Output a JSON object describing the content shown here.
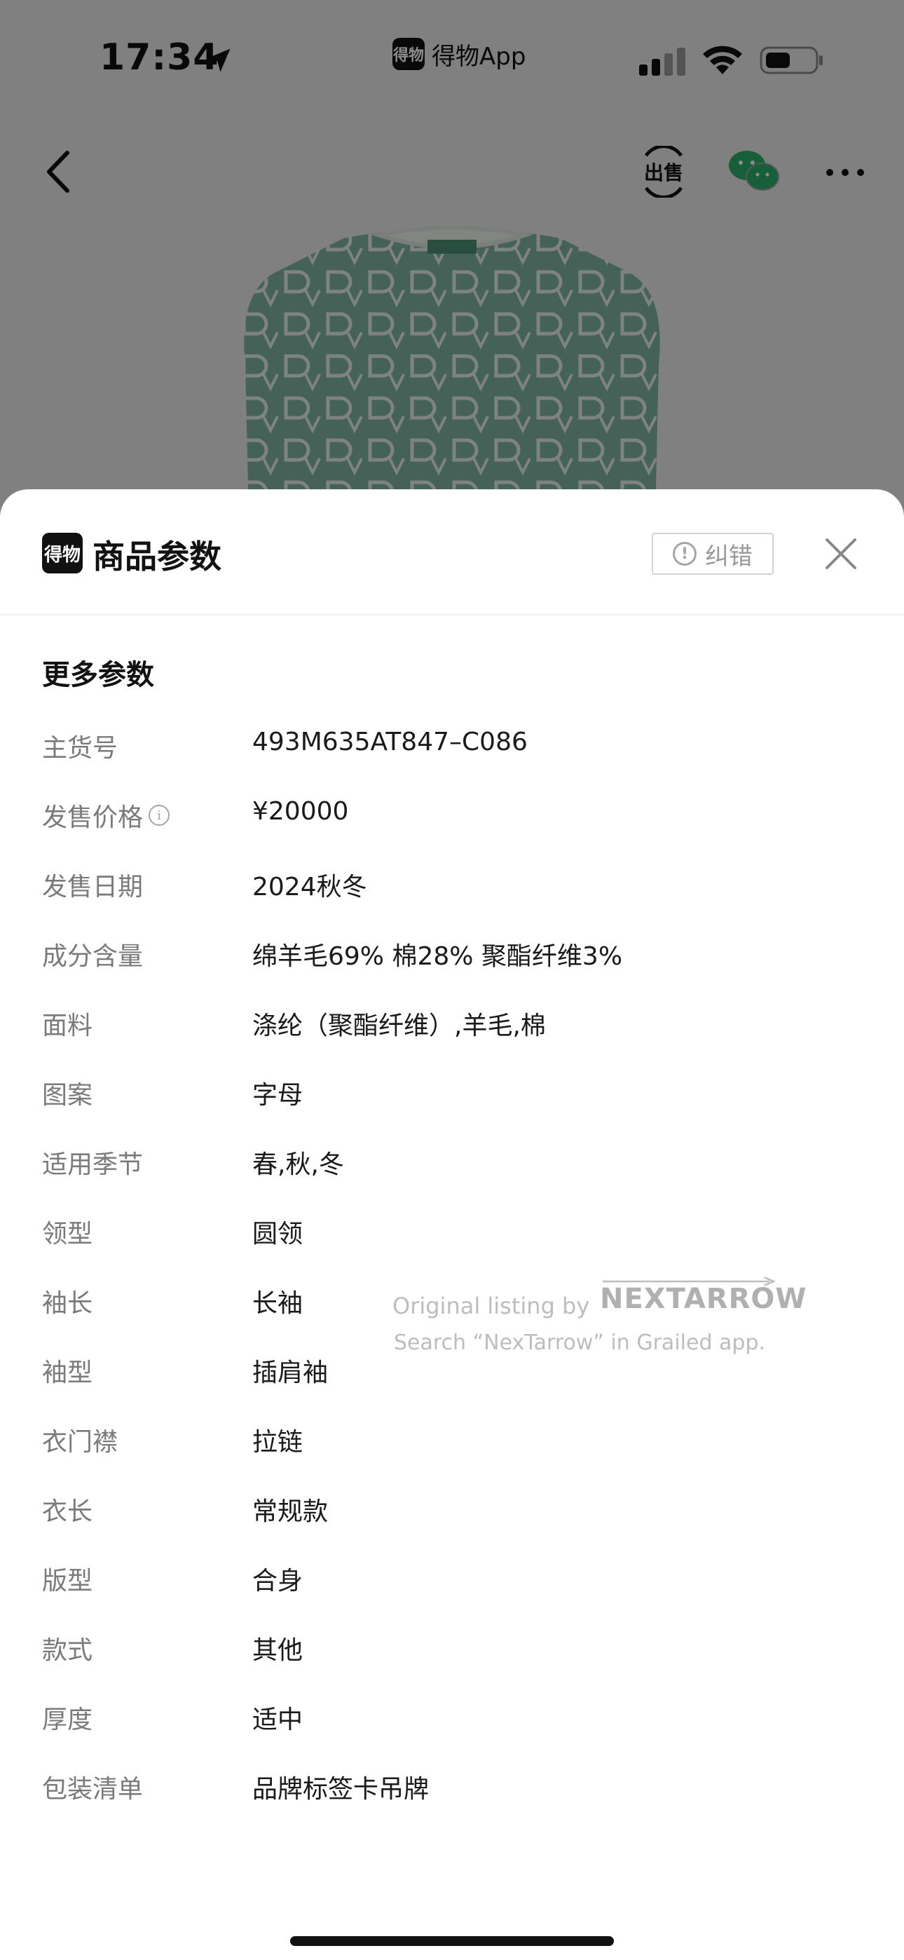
{
  "status_bar": {
    "time": "17:34",
    "app_badge": "得物",
    "app_name": "得物App"
  },
  "nav": {
    "sell_label": "出售"
  },
  "sheet": {
    "logo_text": "得物",
    "title": "商品参数",
    "correct_label": "纠错",
    "section_title": "更多参数",
    "params": [
      {
        "label": "主货号",
        "value": "493M635AT847–C086"
      },
      {
        "label": "发售价格",
        "value": "¥20000"
      },
      {
        "label": "发售日期",
        "value": "2024秋冬"
      },
      {
        "label": "成分含量",
        "value": "绵羊毛69% 棉28% 聚酯纤维3%"
      },
      {
        "label": "面料",
        "value": "涤纶（聚酯纤维）,羊毛,棉"
      },
      {
        "label": "图案",
        "value": "字母"
      },
      {
        "label": "适用季节",
        "value": "春,秋,冬"
      },
      {
        "label": "领型",
        "value": "圆领"
      },
      {
        "label": "袖长",
        "value": "长袖"
      },
      {
        "label": "袖型",
        "value": "插肩袖"
      },
      {
        "label": "衣门襟",
        "value": "拉链"
      },
      {
        "label": "衣长",
        "value": "常规款"
      },
      {
        "label": "版型",
        "value": "合身"
      },
      {
        "label": "款式",
        "value": "其他"
      },
      {
        "label": "厚度",
        "value": "适中"
      },
      {
        "label": "包装清单",
        "value": "品牌标签卡吊牌"
      }
    ]
  },
  "watermark": {
    "line1": "Original listing by",
    "brand": "NEXTARROW",
    "line2": "Search “NexTarrow” in Grailed app."
  },
  "colors": {
    "sheet_bg": "#ffffff",
    "label_gray": "#7a7a7a",
    "wechat_green": "#2aae67",
    "sweater_green": "#7fb3a0"
  }
}
